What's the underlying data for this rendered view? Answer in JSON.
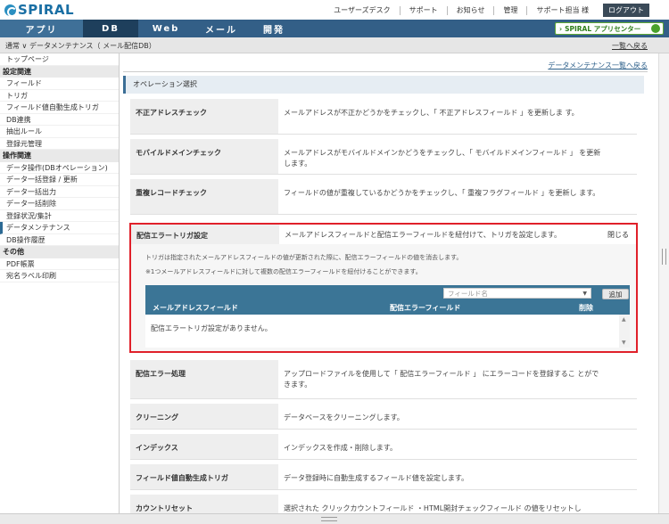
{
  "header": {
    "logo": "SPIRAL",
    "links": [
      "ユーザーズデスク",
      "サポート",
      "お知らせ",
      "管理",
      "サポート担当 様"
    ],
    "logout": "ログアウト"
  },
  "nav": {
    "tabs": [
      "アプリ",
      "DB",
      "Web",
      "メール",
      "開発"
    ],
    "active": "DB",
    "app_center": "SPIRAL アプリセンター"
  },
  "breadcrumb": {
    "path": "通常 ∨   データメンテナンス（ メール配信DB）",
    "back_link": "一覧へ戻る"
  },
  "sidebar": {
    "top": "トップページ",
    "groups": [
      {
        "title": "設定関連",
        "items": [
          "フィールド",
          "トリガ",
          "フィールド値自動生成トリガ",
          "DB連携",
          "抽出ルール",
          "登録元管理"
        ]
      },
      {
        "title": "操作関連",
        "items": [
          "データ操作(DBオペレーション)",
          "データ一括登録 / 更新",
          "データ一括出力",
          "データ一括削除",
          "登録状況/集計",
          "データメンテナンス",
          "DB操作履歴"
        ]
      },
      {
        "title": "その他",
        "items": [
          "PDF帳票",
          "宛名ラベル印刷"
        ]
      }
    ],
    "active_item": "データメンテナンス"
  },
  "main": {
    "list_link": "データメンテナンス一覧へ戻る",
    "section_title": "オペレーション選択",
    "rows_top": [
      {
        "label": "不正アドレスチェック",
        "desc": "メールアドレスが不正かどうかをチェックし、「 不正アドレスフィールド 」を更新しま す。"
      },
      {
        "label": "モバイルドメインチェック",
        "desc": "メールアドレスがモバイルドメインかどうをチェックし、「 モバイルドメインフィールド 」 を更新します。"
      },
      {
        "label": "重複レコードチェック",
        "desc": "フィールドの値が重複しているかどうかをチェックし、「 重複フラグフィールド 」を更新し ます。"
      }
    ],
    "trigger_panel": {
      "label": "配信エラートリガ設定",
      "desc": "メールアドレスフィールドと配信エラーフィールドを紐付けて、トリガを設定します。",
      "close": "閉じる",
      "note1": "トリガは指定されたメールアドレスフィールドの値が更新された際に、配信エラーフィールドの値を消去します。",
      "note2": "※1つメールアドレスフィールドに対して複数の配信エラーフィールドを紐付けることができます。",
      "field_placeholder": "フィールド名",
      "add_button": "追加",
      "columns": [
        "メールアドレスフィールド",
        "配信エラーフィールド",
        "削除"
      ],
      "empty": "配信エラートリガ設定がありません。"
    },
    "rows_bottom": [
      {
        "label": "配信エラー処理",
        "desc": "アップロードファイルを使用して「 配信エラーフィールド 」 にエラーコードを登録するこ とができます。"
      },
      {
        "label": "クリーニング",
        "desc": "データベースをクリーニングします。"
      },
      {
        "label": "インデックス",
        "desc": "インデックスを作成・削除します。"
      },
      {
        "label": "フィールド値自動生成トリガ",
        "desc": "データ登録時に自動生成するフィールド値を設定します。"
      },
      {
        "label": "カウントリセット",
        "desc": "選択された クリックカウントフィールド ・HTML開封チェックフィールド の値をリセットし"
      }
    ]
  }
}
